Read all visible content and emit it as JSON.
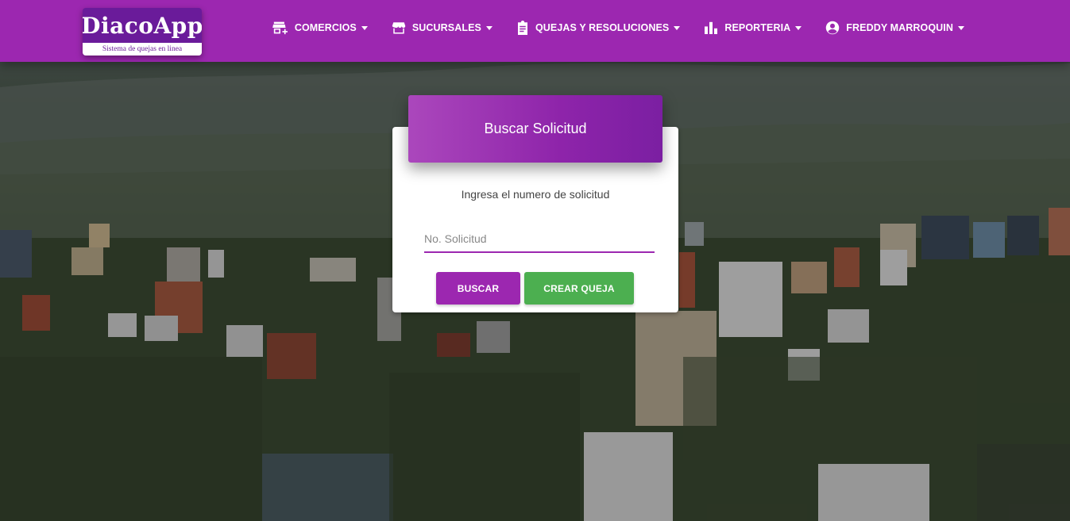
{
  "app": {
    "logo_title": "DiacoApp",
    "logo_tagline": "Sistema de quejas en linea"
  },
  "nav": {
    "items": [
      {
        "label": "COMERCIOS",
        "icon": "store-add-icon"
      },
      {
        "label": "SUCURSALES",
        "icon": "storefront-icon"
      },
      {
        "label": "QUEJAS Y RESOLUCIONES",
        "icon": "clipboard-icon"
      },
      {
        "label": "REPORTERIA",
        "icon": "bar-chart-icon"
      },
      {
        "label": "FREDDY MARROQUIN",
        "icon": "account-circle-icon"
      }
    ]
  },
  "search_card": {
    "title": "Buscar Solicitud",
    "subtitle": "Ingresa el numero de solicitud",
    "input_placeholder": "No. Solicitud",
    "input_value": "",
    "search_button": "BUSCAR",
    "create_button": "CREAR QUEJA"
  },
  "colors": {
    "primary": "#9c27b0",
    "primary_dark": "#6a1b9a",
    "success": "#4caf50"
  }
}
